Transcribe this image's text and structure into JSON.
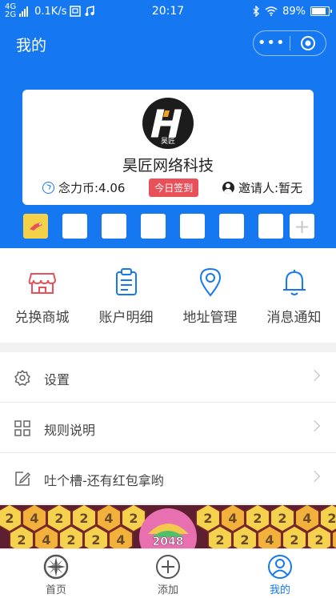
{
  "status_bar": {
    "network_top": "4G",
    "network_bottom": "2G",
    "speed": "0.1K/s",
    "time": "20:17",
    "battery": "89%",
    "battery_level": 0.89
  },
  "header": {
    "title": "我的",
    "more_label": "•••"
  },
  "profile": {
    "avatar_text": "昊匠",
    "company": "昊匠网络科技",
    "coins": "念力币:4.06",
    "checkin_label": "今日签到",
    "inviter": "邀请人:暂无"
  },
  "slots": {
    "count": 7,
    "add_label": "+"
  },
  "grid_menu": [
    {
      "label": "兑换商城",
      "icon": "shop-icon",
      "color": "#e8515a"
    },
    {
      "label": "账户明细",
      "icon": "clipboard-icon",
      "color": "#1678f0"
    },
    {
      "label": "地址管理",
      "icon": "location-pin-icon",
      "color": "#1678f0"
    },
    {
      "label": "消息通知",
      "icon": "bell-icon",
      "color": "#1678f0"
    }
  ],
  "list": [
    {
      "label": "设置",
      "icon": "gear-icon"
    },
    {
      "label": "规则说明",
      "icon": "grid-icon"
    },
    {
      "label": "吐个槽-还有红包拿哟",
      "icon": "edit-icon"
    }
  ],
  "ad_banner": {
    "tile_value": "2",
    "tile_value_alt": "4",
    "score": "2048"
  },
  "tab_bar": [
    {
      "label": "首页",
      "icon": "home-wheel-icon",
      "active": false
    },
    {
      "label": "添加",
      "icon": "add-circle-icon",
      "active": false
    },
    {
      "label": "我的",
      "icon": "user-circle-icon",
      "active": true
    }
  ],
  "colors": {
    "primary": "#1678f0",
    "accent_red": "#e8515a",
    "slot_yellow": "#f3d24a"
  }
}
